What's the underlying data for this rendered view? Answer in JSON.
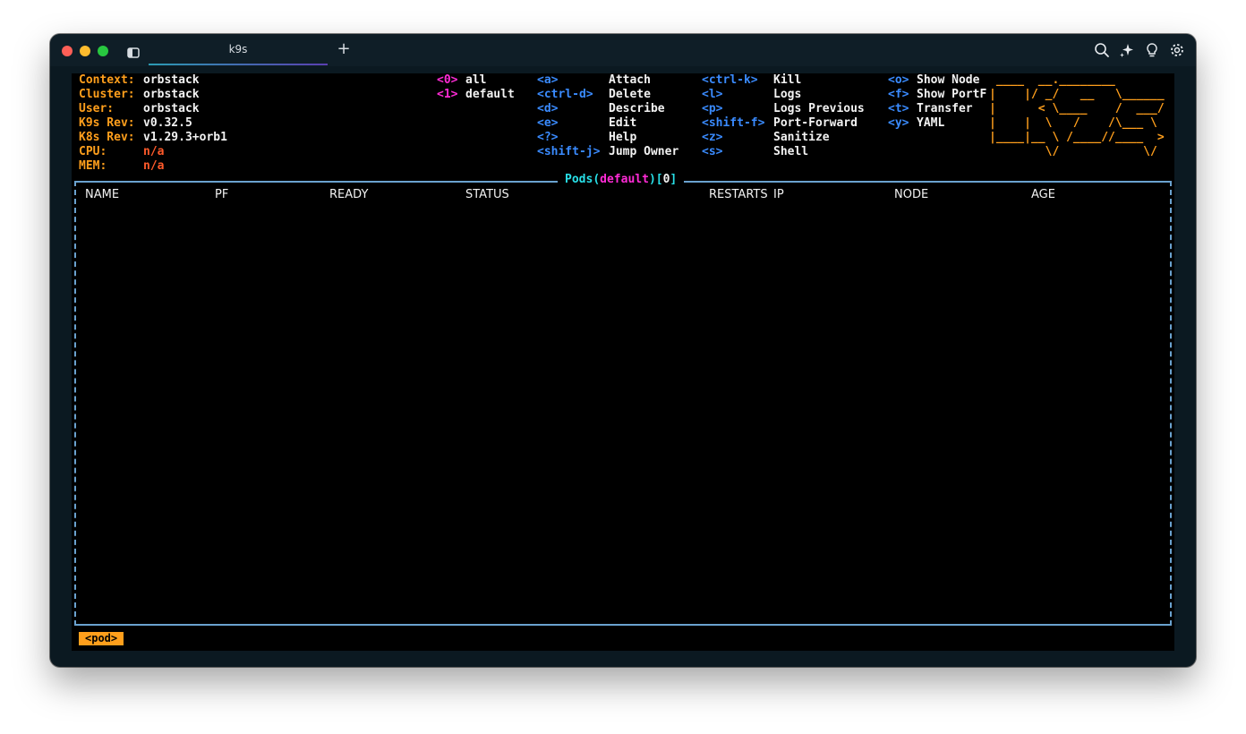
{
  "window": {
    "tab_title": "k9s",
    "new_tab_label": "+"
  },
  "header": {
    "info": [
      {
        "key": "Context:",
        "value": "orbstack",
        "value_color": "white"
      },
      {
        "key": "Cluster:",
        "value": "orbstack",
        "value_color": "white"
      },
      {
        "key": "User:",
        "value": "orbstack",
        "value_color": "white"
      },
      {
        "key": "K9s Rev:",
        "value": "v0.32.5",
        "value_color": "white"
      },
      {
        "key": "K8s Rev:",
        "value": "v1.29.3+orb1",
        "value_color": "white"
      },
      {
        "key": "CPU:",
        "value": "n/a",
        "value_color": "red"
      },
      {
        "key": "MEM:",
        "value": "n/a",
        "value_color": "red"
      }
    ],
    "namespaces": [
      {
        "key": "<0>",
        "label": "all"
      },
      {
        "key": "<1>",
        "label": "default"
      }
    ],
    "shortcuts_col1": [
      {
        "key": "<a>",
        "label": "Attach"
      },
      {
        "key": "<ctrl-d>",
        "label": "Delete"
      },
      {
        "key": "<d>",
        "label": "Describe"
      },
      {
        "key": "<e>",
        "label": "Edit"
      },
      {
        "key": "<?>",
        "label": "Help"
      },
      {
        "key": "<shift-j>",
        "label": "Jump Owner"
      }
    ],
    "shortcuts_col2": [
      {
        "key": "<ctrl-k>",
        "label": "Kill"
      },
      {
        "key": "<l>",
        "label": "Logs"
      },
      {
        "key": "<p>",
        "label": "Logs Previous"
      },
      {
        "key": "<shift-f>",
        "label": "Port-Forward"
      },
      {
        "key": "<z>",
        "label": "Sanitize"
      },
      {
        "key": "<s>",
        "label": "Shell"
      }
    ],
    "shortcuts_col3": [
      {
        "key": "<o>",
        "label": "Show Node"
      },
      {
        "key": "<f>",
        "label": "Show PortF"
      },
      {
        "key": "<t>",
        "label": "Transfer"
      },
      {
        "key": "<y>",
        "label": "YAML"
      }
    ],
    "logo_ascii": " ____  __.________\n|    |/ _/   __   \\______\n|      < \\____    /  ___/\n|    |  \\   /    /\\___ \\\n|____|__ \\ /____//____  >\n        \\/            \\/"
  },
  "table": {
    "resource": "Pods",
    "namespace": "default",
    "count": "0",
    "columns": [
      "NAME",
      "PF",
      "READY",
      "STATUS",
      "RESTARTS",
      "IP",
      "NODE",
      "AGE"
    ],
    "rows": []
  },
  "breadcrumb": "<pod>",
  "colors": {
    "header_key": "#ff9f1c",
    "value": "#f2f2f2",
    "alert": "#ff5a2a",
    "namespace_key": "#ff2bd6",
    "shortcut_key": "#3a8bff",
    "title": "#28e0e8",
    "border": "#6aa2cf"
  }
}
